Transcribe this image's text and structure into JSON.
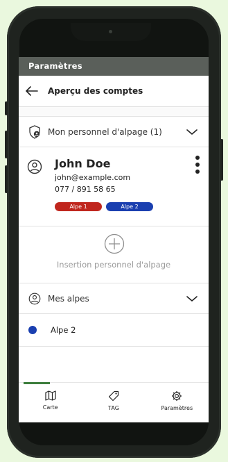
{
  "header": {
    "title": "Paramètres"
  },
  "subheader": {
    "title": "Aperçu des comptes",
    "back_icon": "arrow-left-icon"
  },
  "personnel_section": {
    "label": "Mon personnel d'alpage (1)",
    "icon": "shield-user-icon"
  },
  "person": {
    "name": "John Doe",
    "email": "john@example.com",
    "phone": "077 / 891 58 65",
    "badges": [
      {
        "label": "Alpe 1",
        "color": "#c0261e"
      },
      {
        "label": "Alpe 2",
        "color": "#1a3fb0"
      }
    ]
  },
  "insert": {
    "label": "Insertion personnel d'alpage"
  },
  "alpes_section": {
    "label": "Mes alpes",
    "icon": "user-circle-icon"
  },
  "alpes": [
    {
      "label": "Alpe 2",
      "color": "#1a3fb0"
    }
  ],
  "tabs": [
    {
      "label": "Carte",
      "icon": "map-icon",
      "active": true
    },
    {
      "label": "TAG",
      "icon": "tag-icon",
      "active": false
    },
    {
      "label": "Paramètres",
      "icon": "gear-icon",
      "active": false
    }
  ],
  "colors": {
    "topbar": "#5a5f5a",
    "accent": "#3c7d3c",
    "background": "#eaf8de"
  }
}
